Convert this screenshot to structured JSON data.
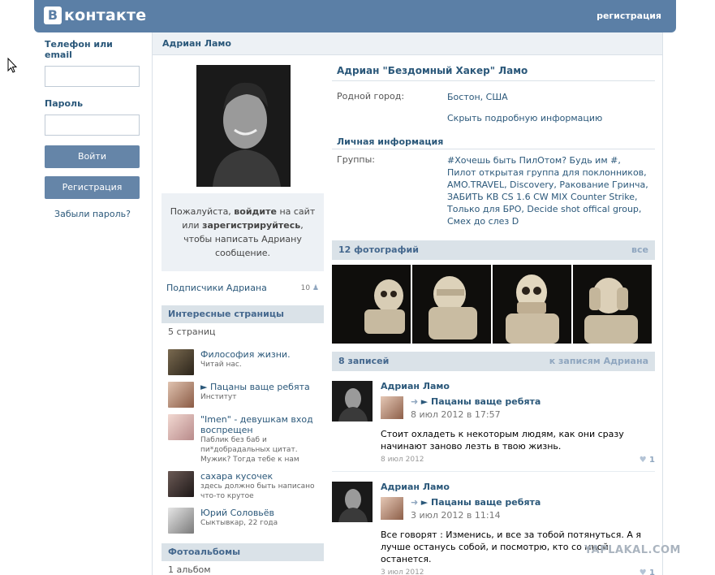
{
  "header": {
    "logo_letter": "В",
    "logo_text": "контакте",
    "register_link": "регистрация"
  },
  "login": {
    "phone_label": "Телефон или email",
    "phone_value": "",
    "password_label": "Пароль",
    "password_value": "",
    "login_button": "Войти",
    "register_button": "Регистрация",
    "forgot_link": "Забыли пароль?"
  },
  "profile": {
    "name_bar": "Адриан Ламо",
    "full_name": "Адриан \"Бездомный Хакер\" Ламо",
    "info": [
      {
        "key": "Родной город:",
        "value": "Бостон, США"
      }
    ],
    "hide_link": "Скрыть подробную информацию",
    "personal_heading": "Личная информация",
    "groups_key": "Группы:",
    "groups_value": "#Хочешь быть ПилОтом? Будь им #, Пилот открытая группа для поклонников, AMO.TRAVEL, Discovery, Ракование Гринча, ЗАБИТЬ КВ CS 1.6 CW MIX Counter Strike, Только для БРО, Decide shot offical group, Смех до слез D"
  },
  "message_box": {
    "p1": "Пожалуйста, ",
    "b1": "войдите",
    "p2": " на сайт или ",
    "b2": "зарегистрируйтесь",
    "p3": ", чтобы написать Адриану сообщение."
  },
  "subscribers": {
    "label": "Подписчики Адриана",
    "count": "10"
  },
  "interesting": {
    "heading": "Интересные страницы",
    "count_text": "5 страниц",
    "items": [
      {
        "title": "Философия жизни.",
        "desc": "Читай нас."
      },
      {
        "title": "► Пацаны ваще ребята",
        "desc": "Институт"
      },
      {
        "title": "\"Imen\" - девушкам вход воспрещен",
        "desc": "Паблик без баб и пи*добрадальных цитат. Мужик? Тогда тебе к нам"
      },
      {
        "title": "сахара кусочек",
        "desc": "здесь должно быть написано что-то крутое"
      },
      {
        "title": "Юрий Соловьёв",
        "desc": "Сыктывкар, 22 года"
      }
    ]
  },
  "albums": {
    "heading": "Фотоальбомы",
    "count_text": "1 альбом"
  },
  "photos": {
    "heading": "12 фотографий",
    "all_link": "все"
  },
  "wall": {
    "heading": "8 записей",
    "link": "к записям Адриана",
    "posts": [
      {
        "author": "Адриан Ламо",
        "repost_title": "► Пацаны ваще ребята",
        "repost_date": "8 июл 2012 в 17:57",
        "text": "Стоит охладеть к некоторым людям, как они сразу начинают заново лезть в твою жизнь.",
        "date": "8 июл 2012",
        "likes": "1"
      },
      {
        "author": "Адриан Ламо",
        "repost_title": "► Пацаны ваще ребята",
        "repost_date": "3 июл 2012 в 11:14",
        "text": "Все говорят : Изменись, и все за тобой потянуться. А я лучше останусь собой, и посмотрю, кто со мной останется.",
        "date": "3 июл 2012",
        "likes": "1"
      }
    ]
  },
  "watermark": "YAPLAKAL.COM",
  "colors": {
    "brand": "#5b7fa6",
    "link": "#2b587a",
    "section": "#dae2e8"
  }
}
